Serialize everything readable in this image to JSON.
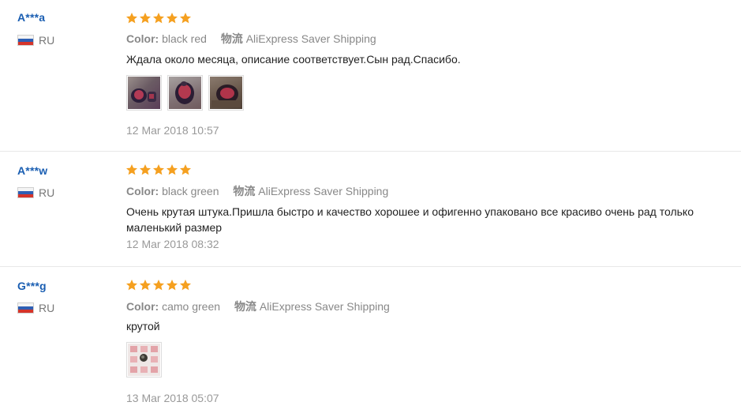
{
  "colors": {
    "username": "#1a5eb2",
    "star": "#f5a020",
    "meta": "#888888",
    "text": "#222222",
    "date": "#999999",
    "divider": "#e8e8e8"
  },
  "reviews": [
    {
      "user": "A***a",
      "country": "RU",
      "flag_icon": "russia-flag-icon",
      "stars": 5,
      "color_label": "Color:",
      "color_value": "black red",
      "shipping_label": "物流",
      "shipping_value": "AliExpress Saver Shipping",
      "text": "Ждала около месяца, описание соответствует.Сын рад.Спасибо.",
      "photo_count": 3,
      "date": "12 Mar 2018 10:57"
    },
    {
      "user": "A***w",
      "country": "RU",
      "flag_icon": "russia-flag-icon",
      "stars": 5,
      "color_label": "Color:",
      "color_value": "black green",
      "shipping_label": "物流",
      "shipping_value": "AliExpress Saver Shipping",
      "text_line1": "Очень крутая штука.Пришла быстро и качество хорошее и офигенно упаковано все красиво очень рад только",
      "text_line2": "маленький размер",
      "photo_count": 0,
      "date": "12 Mar 2018 08:32"
    },
    {
      "user": "G***g",
      "country": "RU",
      "flag_icon": "russia-flag-icon",
      "stars": 5,
      "color_label": "Color:",
      "color_value": "camo green",
      "shipping_label": "物流",
      "shipping_value": "AliExpress Saver Shipping",
      "text": "крутой",
      "photo_count": 1,
      "date": "13 Mar 2018 05:07"
    }
  ]
}
